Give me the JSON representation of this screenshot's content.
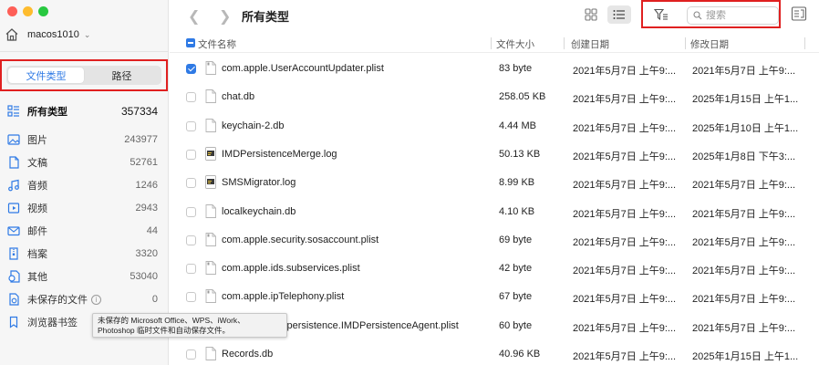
{
  "window": {
    "title": "所有类型"
  },
  "account": {
    "name": "macos1010"
  },
  "sidebar": {
    "segments": [
      {
        "label": "文件类型",
        "active": true
      },
      {
        "label": "路径",
        "active": false
      }
    ],
    "categories": [
      {
        "label": "所有类型",
        "count": "357334",
        "icon": "all-types-icon"
      },
      {
        "label": "图片",
        "count": "243977",
        "icon": "image-icon"
      },
      {
        "label": "文稿",
        "count": "52761",
        "icon": "document-icon"
      },
      {
        "label": "音频",
        "count": "1246",
        "icon": "audio-icon"
      },
      {
        "label": "视频",
        "count": "2943",
        "icon": "video-icon"
      },
      {
        "label": "邮件",
        "count": "44",
        "icon": "mail-icon"
      },
      {
        "label": "档案",
        "count": "3320",
        "icon": "archive-icon"
      },
      {
        "label": "其他",
        "count": "53040",
        "icon": "other-icon"
      },
      {
        "label": "未保存的文件",
        "count": "0",
        "icon": "unsaved-file-icon"
      },
      {
        "label": "浏览器书签",
        "count": "",
        "icon": "bookmark-icon"
      }
    ],
    "tooltip": "未保存的 Microsoft Office、WPS、iWork、Photoshop 临时文件和自动保存文件。"
  },
  "toolbar": {
    "search_placeholder": "搜索"
  },
  "table": {
    "headers": {
      "name": "文件名称",
      "size": "文件大小",
      "created": "创建日期",
      "modified": "修改日期"
    },
    "rows": [
      {
        "name": "com.apple.UserAccountUpdater.plist",
        "size": "83 byte",
        "created": "2021年5月7日 上午9:...",
        "modified": "2021年5月7日 上午9:...",
        "checked": true,
        "icon": "plist-file-icon"
      },
      {
        "name": "chat.db",
        "size": "258.05 KB",
        "created": "2021年5月7日 上午9:...",
        "modified": "2025年1月15日 上午1...",
        "checked": false,
        "icon": "db-file-icon"
      },
      {
        "name": "keychain-2.db",
        "size": "4.44 MB",
        "created": "2021年5月7日 上午9:...",
        "modified": "2025年1月10日 上午1...",
        "checked": false,
        "icon": "db-file-icon"
      },
      {
        "name": "IMDPersistenceMerge.log",
        "size": "50.13 KB",
        "created": "2021年5月7日 上午9:...",
        "modified": "2025年1月8日 下午3:...",
        "checked": false,
        "icon": "log-file-icon"
      },
      {
        "name": "SMSMigrator.log",
        "size": "8.99 KB",
        "created": "2021年5月7日 上午9:...",
        "modified": "2021年5月7日 上午9:...",
        "checked": false,
        "icon": "log-file-icon"
      },
      {
        "name": "localkeychain.db",
        "size": "4.10 KB",
        "created": "2021年5月7日 上午9:...",
        "modified": "2021年5月7日 上午9:...",
        "checked": false,
        "icon": "db-file-icon"
      },
      {
        "name": "com.apple.security.sosaccount.plist",
        "size": "69 byte",
        "created": "2021年5月7日 上午9:...",
        "modified": "2021年5月7日 上午9:...",
        "checked": false,
        "icon": "plist-file-icon"
      },
      {
        "name": "com.apple.ids.subservices.plist",
        "size": "42 byte",
        "created": "2021年5月7日 上午9:...",
        "modified": "2021年5月7日 上午9:...",
        "checked": false,
        "icon": "plist-file-icon"
      },
      {
        "name": "com.apple.ipTelephony.plist",
        "size": "67 byte",
        "created": "2021年5月7日 上午9:...",
        "modified": "2021年5月7日 上午9:...",
        "checked": false,
        "icon": "plist-file-icon"
      },
      {
        "name": "com.apple.imdpersistence.IMDPersistenceAgent.plist",
        "size": "60 byte",
        "created": "2021年5月7日 上午9:...",
        "modified": "2021年5月7日 上午9:...",
        "checked": false,
        "icon": "plist-file-icon"
      },
      {
        "name": "Records.db",
        "size": "40.96 KB",
        "created": "2021年5月7日 上午9:...",
        "modified": "2025年1月15日 上午1...",
        "checked": false,
        "icon": "db-file-icon"
      }
    ]
  },
  "colors": {
    "accent": "#2f7ae5",
    "highlight_border": "#e02020"
  }
}
